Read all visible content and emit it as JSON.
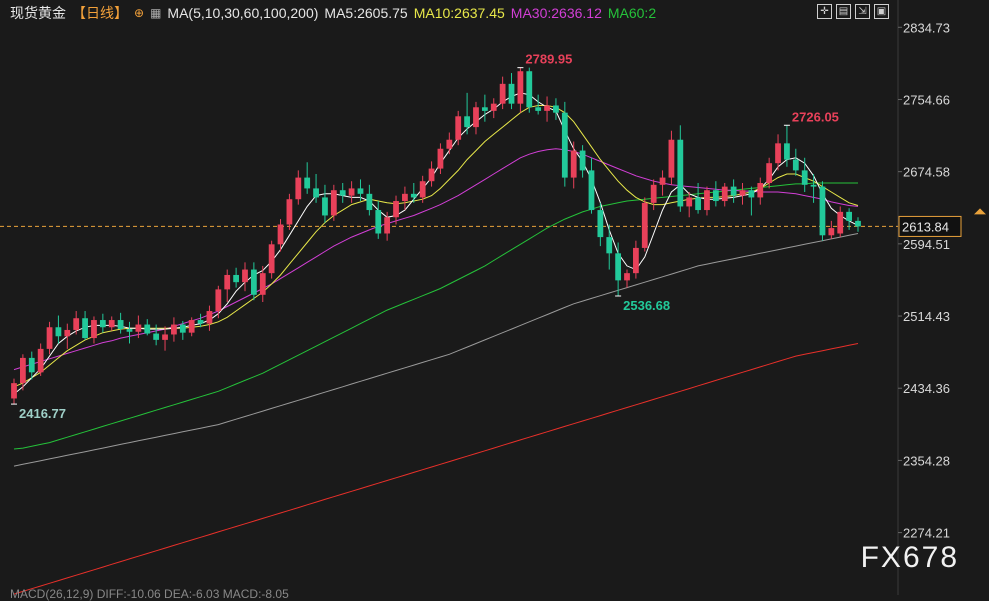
{
  "header": {
    "instrument": "现货黄金",
    "period": "【日线】",
    "ma_spec": "MA(5,10,30,60,100,200)",
    "ma5": "MA5:2605.75",
    "ma10": "MA10:2637.45",
    "ma30": "MA30:2636.12",
    "ma60": "MA60:2"
  },
  "price_tag": "2613.84",
  "watermark": "FX678",
  "footer": "MACD(26,12,9) DIFF:-10.06  DEA:-6.03  MACD:-8.05",
  "colors": {
    "up": "#e8415a",
    "down": "#22c99a",
    "ma5": "#ffffff",
    "ma10": "#e8e84a",
    "ma30": "#d23fd6",
    "ma60": "#25c23a",
    "ma100": "#9a9a9a",
    "ma200": "#e8302a"
  },
  "chart_data": {
    "type": "candlestick",
    "y_ticks": [
      2834.73,
      2754.66,
      2674.58,
      2594.51,
      2514.43,
      2434.36,
      2354.28,
      2274.21
    ],
    "ylim": [
      2205,
      2865
    ],
    "annotations": [
      {
        "label": "2789.95",
        "value": 2789.95,
        "kind": "high"
      },
      {
        "label": "2726.05",
        "value": 2726.05,
        "kind": "high"
      },
      {
        "label": "2536.68",
        "value": 2536.68,
        "kind": "low"
      },
      {
        "label": "2416.77",
        "value": 2416.77,
        "kind": "low"
      }
    ],
    "last_price": 2613.84,
    "candles": [
      {
        "o": 2423,
        "h": 2445,
        "l": 2416.77,
        "c": 2440
      },
      {
        "o": 2440,
        "h": 2472,
        "l": 2432,
        "c": 2468
      },
      {
        "o": 2468,
        "h": 2475,
        "l": 2444,
        "c": 2452
      },
      {
        "o": 2452,
        "h": 2484,
        "l": 2448,
        "c": 2478
      },
      {
        "o": 2478,
        "h": 2508,
        "l": 2472,
        "c": 2502
      },
      {
        "o": 2502,
        "h": 2515,
        "l": 2484,
        "c": 2492
      },
      {
        "o": 2492,
        "h": 2506,
        "l": 2478,
        "c": 2499
      },
      {
        "o": 2499,
        "h": 2520,
        "l": 2494,
        "c": 2512
      },
      {
        "o": 2512,
        "h": 2520,
        "l": 2488,
        "c": 2490
      },
      {
        "o": 2490,
        "h": 2514,
        "l": 2484,
        "c": 2510
      },
      {
        "o": 2510,
        "h": 2517,
        "l": 2496,
        "c": 2502
      },
      {
        "o": 2502,
        "h": 2514,
        "l": 2498,
        "c": 2510
      },
      {
        "o": 2510,
        "h": 2518,
        "l": 2495,
        "c": 2500
      },
      {
        "o": 2500,
        "h": 2508,
        "l": 2484,
        "c": 2497
      },
      {
        "o": 2497,
        "h": 2515,
        "l": 2490,
        "c": 2505
      },
      {
        "o": 2505,
        "h": 2511,
        "l": 2493,
        "c": 2495
      },
      {
        "o": 2495,
        "h": 2505,
        "l": 2482,
        "c": 2488
      },
      {
        "o": 2488,
        "h": 2503,
        "l": 2476,
        "c": 2494
      },
      {
        "o": 2494,
        "h": 2513,
        "l": 2486,
        "c": 2505
      },
      {
        "o": 2505,
        "h": 2509,
        "l": 2488,
        "c": 2496
      },
      {
        "o": 2496,
        "h": 2513,
        "l": 2492,
        "c": 2510
      },
      {
        "o": 2510,
        "h": 2517,
        "l": 2502,
        "c": 2506
      },
      {
        "o": 2506,
        "h": 2526,
        "l": 2498,
        "c": 2520
      },
      {
        "o": 2520,
        "h": 2548,
        "l": 2512,
        "c": 2544
      },
      {
        "o": 2544,
        "h": 2566,
        "l": 2530,
        "c": 2560
      },
      {
        "o": 2560,
        "h": 2568,
        "l": 2546,
        "c": 2552
      },
      {
        "o": 2552,
        "h": 2574,
        "l": 2542,
        "c": 2566
      },
      {
        "o": 2566,
        "h": 2574,
        "l": 2532,
        "c": 2538
      },
      {
        "o": 2538,
        "h": 2570,
        "l": 2530,
        "c": 2562
      },
      {
        "o": 2562,
        "h": 2598,
        "l": 2556,
        "c": 2594
      },
      {
        "o": 2594,
        "h": 2622,
        "l": 2586,
        "c": 2616
      },
      {
        "o": 2616,
        "h": 2650,
        "l": 2610,
        "c": 2644
      },
      {
        "o": 2644,
        "h": 2676,
        "l": 2638,
        "c": 2668
      },
      {
        "o": 2668,
        "h": 2685,
        "l": 2650,
        "c": 2656
      },
      {
        "o": 2656,
        "h": 2672,
        "l": 2640,
        "c": 2646
      },
      {
        "o": 2646,
        "h": 2660,
        "l": 2618,
        "c": 2626
      },
      {
        "o": 2626,
        "h": 2660,
        "l": 2620,
        "c": 2654
      },
      {
        "o": 2654,
        "h": 2662,
        "l": 2640,
        "c": 2648
      },
      {
        "o": 2648,
        "h": 2664,
        "l": 2640,
        "c": 2656
      },
      {
        "o": 2656,
        "h": 2666,
        "l": 2642,
        "c": 2650
      },
      {
        "o": 2650,
        "h": 2660,
        "l": 2626,
        "c": 2632
      },
      {
        "o": 2632,
        "h": 2642,
        "l": 2600,
        "c": 2606
      },
      {
        "o": 2606,
        "h": 2630,
        "l": 2598,
        "c": 2624
      },
      {
        "o": 2624,
        "h": 2648,
        "l": 2616,
        "c": 2642
      },
      {
        "o": 2642,
        "h": 2658,
        "l": 2632,
        "c": 2650
      },
      {
        "o": 2650,
        "h": 2662,
        "l": 2640,
        "c": 2646
      },
      {
        "o": 2646,
        "h": 2670,
        "l": 2640,
        "c": 2664
      },
      {
        "o": 2664,
        "h": 2686,
        "l": 2658,
        "c": 2678
      },
      {
        "o": 2678,
        "h": 2706,
        "l": 2672,
        "c": 2700
      },
      {
        "o": 2700,
        "h": 2718,
        "l": 2694,
        "c": 2710
      },
      {
        "o": 2710,
        "h": 2742,
        "l": 2704,
        "c": 2736
      },
      {
        "o": 2736,
        "h": 2762,
        "l": 2716,
        "c": 2724
      },
      {
        "o": 2724,
        "h": 2752,
        "l": 2716,
        "c": 2746
      },
      {
        "o": 2746,
        "h": 2760,
        "l": 2730,
        "c": 2742
      },
      {
        "o": 2742,
        "h": 2756,
        "l": 2734,
        "c": 2750
      },
      {
        "o": 2750,
        "h": 2780,
        "l": 2744,
        "c": 2772
      },
      {
        "o": 2772,
        "h": 2784,
        "l": 2744,
        "c": 2750
      },
      {
        "o": 2750,
        "h": 2789.95,
        "l": 2740,
        "c": 2786
      },
      {
        "o": 2786,
        "h": 2790,
        "l": 2740,
        "c": 2746
      },
      {
        "o": 2746,
        "h": 2760,
        "l": 2738,
        "c": 2742
      },
      {
        "o": 2742,
        "h": 2758,
        "l": 2730,
        "c": 2748
      },
      {
        "o": 2748,
        "h": 2756,
        "l": 2732,
        "c": 2740
      },
      {
        "o": 2740,
        "h": 2752,
        "l": 2658,
        "c": 2668
      },
      {
        "o": 2668,
        "h": 2708,
        "l": 2656,
        "c": 2698
      },
      {
        "o": 2698,
        "h": 2704,
        "l": 2668,
        "c": 2676
      },
      {
        "o": 2676,
        "h": 2690,
        "l": 2628,
        "c": 2632
      },
      {
        "o": 2632,
        "h": 2640,
        "l": 2592,
        "c": 2602
      },
      {
        "o": 2602,
        "h": 2616,
        "l": 2566,
        "c": 2584
      },
      {
        "o": 2584,
        "h": 2596,
        "l": 2536.68,
        "c": 2554
      },
      {
        "o": 2554,
        "h": 2566,
        "l": 2546,
        "c": 2562
      },
      {
        "o": 2562,
        "h": 2598,
        "l": 2556,
        "c": 2590
      },
      {
        "o": 2590,
        "h": 2646,
        "l": 2586,
        "c": 2640
      },
      {
        "o": 2640,
        "h": 2666,
        "l": 2632,
        "c": 2660
      },
      {
        "o": 2660,
        "h": 2676,
        "l": 2648,
        "c": 2668
      },
      {
        "o": 2668,
        "h": 2720,
        "l": 2660,
        "c": 2710
      },
      {
        "o": 2710,
        "h": 2726,
        "l": 2630,
        "c": 2636
      },
      {
        "o": 2636,
        "h": 2652,
        "l": 2624,
        "c": 2646
      },
      {
        "o": 2646,
        "h": 2662,
        "l": 2628,
        "c": 2632
      },
      {
        "o": 2632,
        "h": 2658,
        "l": 2626,
        "c": 2654
      },
      {
        "o": 2654,
        "h": 2664,
        "l": 2636,
        "c": 2642
      },
      {
        "o": 2642,
        "h": 2662,
        "l": 2636,
        "c": 2658
      },
      {
        "o": 2658,
        "h": 2666,
        "l": 2640,
        "c": 2648
      },
      {
        "o": 2648,
        "h": 2662,
        "l": 2638,
        "c": 2654
      },
      {
        "o": 2654,
        "h": 2658,
        "l": 2626,
        "c": 2646
      },
      {
        "o": 2646,
        "h": 2668,
        "l": 2638,
        "c": 2662
      },
      {
        "o": 2662,
        "h": 2690,
        "l": 2656,
        "c": 2684
      },
      {
        "o": 2684,
        "h": 2716,
        "l": 2676,
        "c": 2706
      },
      {
        "o": 2706,
        "h": 2726.05,
        "l": 2680,
        "c": 2688
      },
      {
        "o": 2688,
        "h": 2700,
        "l": 2670,
        "c": 2676
      },
      {
        "o": 2676,
        "h": 2690,
        "l": 2652,
        "c": 2660
      },
      {
        "o": 2660,
        "h": 2672,
        "l": 2640,
        "c": 2658
      },
      {
        "o": 2658,
        "h": 2664,
        "l": 2598,
        "c": 2604
      },
      {
        "o": 2604,
        "h": 2620,
        "l": 2600,
        "c": 2612
      },
      {
        "o": 2606,
        "h": 2636,
        "l": 2602,
        "c": 2630
      },
      {
        "o": 2630,
        "h": 2634,
        "l": 2610,
        "c": 2620
      },
      {
        "o": 2620,
        "h": 2624,
        "l": 2608,
        "c": 2613.84
      }
    ],
    "ma_lines": {
      "ma5": [
        2428,
        2436,
        2446,
        2456,
        2470,
        2484,
        2492,
        2498,
        2502,
        2504,
        2504,
        2504,
        2503,
        2501,
        2501,
        2500,
        2500,
        2500,
        2501,
        2502,
        2504,
        2506,
        2510,
        2517,
        2528,
        2542,
        2552,
        2560,
        2565,
        2575,
        2588,
        2604,
        2620,
        2636,
        2648,
        2650,
        2650,
        2648,
        2646,
        2646,
        2642,
        2632,
        2624,
        2626,
        2632,
        2644,
        2656,
        2668,
        2684,
        2698,
        2712,
        2722,
        2730,
        2738,
        2744,
        2752,
        2758,
        2762,
        2760,
        2752,
        2746,
        2742,
        2720,
        2700,
        2686,
        2666,
        2640,
        2610,
        2584,
        2570,
        2566,
        2580,
        2606,
        2632,
        2652,
        2660,
        2650,
        2646,
        2644,
        2644,
        2645,
        2646,
        2648,
        2650,
        2656,
        2666,
        2680,
        2688,
        2690,
        2684,
        2670,
        2650,
        2634,
        2626,
        2620,
        2615
      ],
      "ma10": [
        2436,
        2440,
        2446,
        2452,
        2460,
        2468,
        2476,
        2482,
        2488,
        2492,
        2496,
        2498,
        2500,
        2501,
        2501,
        2501,
        2501,
        2501,
        2501,
        2501,
        2502,
        2503,
        2505,
        2508,
        2513,
        2520,
        2527,
        2534,
        2541,
        2550,
        2560,
        2572,
        2584,
        2596,
        2608,
        2618,
        2626,
        2632,
        2638,
        2641,
        2644,
        2642,
        2640,
        2639,
        2640,
        2642,
        2644,
        2648,
        2656,
        2666,
        2676,
        2688,
        2698,
        2708,
        2716,
        2724,
        2732,
        2740,
        2746,
        2748,
        2748,
        2746,
        2740,
        2730,
        2716,
        2702,
        2688,
        2676,
        2664,
        2654,
        2646,
        2641,
        2638,
        2638,
        2640,
        2642,
        2644,
        2645,
        2646,
        2646,
        2647,
        2648,
        2650,
        2652,
        2656,
        2662,
        2668,
        2672,
        2672,
        2668,
        2664,
        2658,
        2652,
        2646,
        2640,
        2637
      ],
      "ma30": [
        2455,
        2458,
        2461,
        2464,
        2467,
        2470,
        2473,
        2476,
        2479,
        2482,
        2485,
        2487,
        2490,
        2492,
        2494,
        2496,
        2498,
        2500,
        2503,
        2506,
        2509,
        2512,
        2516,
        2520,
        2525,
        2530,
        2535,
        2540,
        2545,
        2550,
        2556,
        2562,
        2568,
        2574,
        2580,
        2586,
        2592,
        2597,
        2602,
        2606,
        2610,
        2614,
        2617,
        2620,
        2623,
        2626,
        2630,
        2634,
        2638,
        2643,
        2648,
        2654,
        2660,
        2666,
        2672,
        2678,
        2684,
        2690,
        2694,
        2697,
        2699,
        2700,
        2699,
        2697,
        2694,
        2690,
        2686,
        2682,
        2678,
        2674,
        2670,
        2667,
        2664,
        2662,
        2660,
        2659,
        2658,
        2657,
        2656,
        2655,
        2654,
        2654,
        2653,
        2653,
        2652,
        2652,
        2652,
        2651,
        2650,
        2648,
        2646,
        2644,
        2641,
        2639,
        2637,
        2636
      ],
      "ma60": [
        2367,
        2368,
        2370,
        2372,
        2374,
        2377,
        2380,
        2383,
        2386,
        2389,
        2392,
        2395,
        2398,
        2401,
        2404,
        2407,
        2410,
        2413,
        2416,
        2419,
        2422,
        2425,
        2428,
        2431,
        2435,
        2439,
        2443,
        2447,
        2451,
        2456,
        2461,
        2466,
        2471,
        2476,
        2481,
        2486,
        2491,
        2496,
        2501,
        2506,
        2511,
        2516,
        2521,
        2525,
        2529,
        2533,
        2537,
        2541,
        2545,
        2550,
        2555,
        2560,
        2565,
        2570,
        2576,
        2582,
        2588,
        2594,
        2600,
        2606,
        2612,
        2617,
        2622,
        2626,
        2630,
        2633,
        2636,
        2638,
        2640,
        2642,
        2643,
        2644,
        2645,
        2646,
        2647,
        2648,
        2649,
        2650,
        2651,
        2652,
        2653,
        2654,
        2655,
        2656,
        2657,
        2658,
        2659,
        2660,
        2661,
        2661,
        2662,
        2662,
        2662,
        2662,
        2662,
        2662
      ],
      "ma100": [
        2348,
        2350,
        2352,
        2354,
        2356,
        2358,
        2360,
        2362,
        2364,
        2366,
        2368,
        2370,
        2372,
        2374,
        2376,
        2378,
        2380,
        2382,
        2384,
        2386,
        2388,
        2390,
        2392,
        2394,
        2397,
        2400,
        2403,
        2406,
        2409,
        2412,
        2415,
        2418,
        2421,
        2424,
        2427,
        2430,
        2433,
        2436,
        2439,
        2442,
        2445,
        2448,
        2451,
        2454,
        2457,
        2460,
        2463,
        2466,
        2469,
        2472,
        2476,
        2480,
        2484,
        2488,
        2492,
        2496,
        2500,
        2504,
        2508,
        2512,
        2516,
        2520,
        2524,
        2528,
        2531,
        2534,
        2537,
        2540,
        2543,
        2546,
        2549,
        2552,
        2555,
        2558,
        2561,
        2564,
        2567,
        2570,
        2572,
        2574,
        2576,
        2578,
        2580,
        2582,
        2584,
        2586,
        2588,
        2590,
        2592,
        2594,
        2596,
        2598,
        2600,
        2602,
        2604,
        2606
      ],
      "ma200": [
        2206,
        2209,
        2212,
        2215,
        2218,
        2221,
        2224,
        2227,
        2230,
        2233,
        2236,
        2239,
        2242,
        2245,
        2248,
        2251,
        2254,
        2257,
        2260,
        2263,
        2266,
        2269,
        2272,
        2275,
        2278,
        2281,
        2284,
        2287,
        2290,
        2293,
        2296,
        2299,
        2302,
        2305,
        2308,
        2311,
        2314,
        2317,
        2320,
        2323,
        2326,
        2329,
        2332,
        2335,
        2338,
        2341,
        2344,
        2347,
        2350,
        2353,
        2356,
        2359,
        2362,
        2365,
        2368,
        2371,
        2374,
        2377,
        2380,
        2383,
        2386,
        2389,
        2392,
        2395,
        2398,
        2401,
        2404,
        2407,
        2410,
        2413,
        2416,
        2419,
        2422,
        2425,
        2428,
        2431,
        2434,
        2437,
        2440,
        2443,
        2446,
        2449,
        2452,
        2455,
        2458,
        2461,
        2464,
        2467,
        2470,
        2472,
        2474,
        2476,
        2478,
        2480,
        2482,
        2484
      ]
    }
  }
}
